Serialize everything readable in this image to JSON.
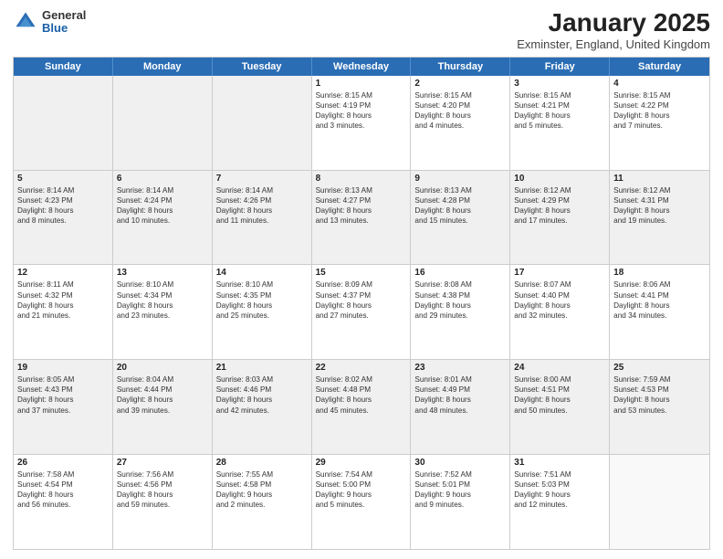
{
  "logo": {
    "general": "General",
    "blue": "Blue"
  },
  "title": {
    "month": "January 2025",
    "location": "Exminster, England, United Kingdom"
  },
  "header_days": [
    "Sunday",
    "Monday",
    "Tuesday",
    "Wednesday",
    "Thursday",
    "Friday",
    "Saturday"
  ],
  "weeks": [
    [
      {
        "day": "",
        "lines": [],
        "shaded": true
      },
      {
        "day": "",
        "lines": [],
        "shaded": true
      },
      {
        "day": "",
        "lines": [],
        "shaded": true
      },
      {
        "day": "1",
        "lines": [
          "Sunrise: 8:15 AM",
          "Sunset: 4:19 PM",
          "Daylight: 8 hours",
          "and 3 minutes."
        ]
      },
      {
        "day": "2",
        "lines": [
          "Sunrise: 8:15 AM",
          "Sunset: 4:20 PM",
          "Daylight: 8 hours",
          "and 4 minutes."
        ]
      },
      {
        "day": "3",
        "lines": [
          "Sunrise: 8:15 AM",
          "Sunset: 4:21 PM",
          "Daylight: 8 hours",
          "and 5 minutes."
        ]
      },
      {
        "day": "4",
        "lines": [
          "Sunrise: 8:15 AM",
          "Sunset: 4:22 PM",
          "Daylight: 8 hours",
          "and 7 minutes."
        ]
      }
    ],
    [
      {
        "day": "5",
        "lines": [
          "Sunrise: 8:14 AM",
          "Sunset: 4:23 PM",
          "Daylight: 8 hours",
          "and 8 minutes."
        ],
        "shaded": true
      },
      {
        "day": "6",
        "lines": [
          "Sunrise: 8:14 AM",
          "Sunset: 4:24 PM",
          "Daylight: 8 hours",
          "and 10 minutes."
        ],
        "shaded": true
      },
      {
        "day": "7",
        "lines": [
          "Sunrise: 8:14 AM",
          "Sunset: 4:26 PM",
          "Daylight: 8 hours",
          "and 11 minutes."
        ],
        "shaded": true
      },
      {
        "day": "8",
        "lines": [
          "Sunrise: 8:13 AM",
          "Sunset: 4:27 PM",
          "Daylight: 8 hours",
          "and 13 minutes."
        ],
        "shaded": true
      },
      {
        "day": "9",
        "lines": [
          "Sunrise: 8:13 AM",
          "Sunset: 4:28 PM",
          "Daylight: 8 hours",
          "and 15 minutes."
        ],
        "shaded": true
      },
      {
        "day": "10",
        "lines": [
          "Sunrise: 8:12 AM",
          "Sunset: 4:29 PM",
          "Daylight: 8 hours",
          "and 17 minutes."
        ],
        "shaded": true
      },
      {
        "day": "11",
        "lines": [
          "Sunrise: 8:12 AM",
          "Sunset: 4:31 PM",
          "Daylight: 8 hours",
          "and 19 minutes."
        ],
        "shaded": true
      }
    ],
    [
      {
        "day": "12",
        "lines": [
          "Sunrise: 8:11 AM",
          "Sunset: 4:32 PM",
          "Daylight: 8 hours",
          "and 21 minutes."
        ]
      },
      {
        "day": "13",
        "lines": [
          "Sunrise: 8:10 AM",
          "Sunset: 4:34 PM",
          "Daylight: 8 hours",
          "and 23 minutes."
        ]
      },
      {
        "day": "14",
        "lines": [
          "Sunrise: 8:10 AM",
          "Sunset: 4:35 PM",
          "Daylight: 8 hours",
          "and 25 minutes."
        ]
      },
      {
        "day": "15",
        "lines": [
          "Sunrise: 8:09 AM",
          "Sunset: 4:37 PM",
          "Daylight: 8 hours",
          "and 27 minutes."
        ]
      },
      {
        "day": "16",
        "lines": [
          "Sunrise: 8:08 AM",
          "Sunset: 4:38 PM",
          "Daylight: 8 hours",
          "and 29 minutes."
        ]
      },
      {
        "day": "17",
        "lines": [
          "Sunrise: 8:07 AM",
          "Sunset: 4:40 PM",
          "Daylight: 8 hours",
          "and 32 minutes."
        ]
      },
      {
        "day": "18",
        "lines": [
          "Sunrise: 8:06 AM",
          "Sunset: 4:41 PM",
          "Daylight: 8 hours",
          "and 34 minutes."
        ]
      }
    ],
    [
      {
        "day": "19",
        "lines": [
          "Sunrise: 8:05 AM",
          "Sunset: 4:43 PM",
          "Daylight: 8 hours",
          "and 37 minutes."
        ],
        "shaded": true
      },
      {
        "day": "20",
        "lines": [
          "Sunrise: 8:04 AM",
          "Sunset: 4:44 PM",
          "Daylight: 8 hours",
          "and 39 minutes."
        ],
        "shaded": true
      },
      {
        "day": "21",
        "lines": [
          "Sunrise: 8:03 AM",
          "Sunset: 4:46 PM",
          "Daylight: 8 hours",
          "and 42 minutes."
        ],
        "shaded": true
      },
      {
        "day": "22",
        "lines": [
          "Sunrise: 8:02 AM",
          "Sunset: 4:48 PM",
          "Daylight: 8 hours",
          "and 45 minutes."
        ],
        "shaded": true
      },
      {
        "day": "23",
        "lines": [
          "Sunrise: 8:01 AM",
          "Sunset: 4:49 PM",
          "Daylight: 8 hours",
          "and 48 minutes."
        ],
        "shaded": true
      },
      {
        "day": "24",
        "lines": [
          "Sunrise: 8:00 AM",
          "Sunset: 4:51 PM",
          "Daylight: 8 hours",
          "and 50 minutes."
        ],
        "shaded": true
      },
      {
        "day": "25",
        "lines": [
          "Sunrise: 7:59 AM",
          "Sunset: 4:53 PM",
          "Daylight: 8 hours",
          "and 53 minutes."
        ],
        "shaded": true
      }
    ],
    [
      {
        "day": "26",
        "lines": [
          "Sunrise: 7:58 AM",
          "Sunset: 4:54 PM",
          "Daylight: 8 hours",
          "and 56 minutes."
        ]
      },
      {
        "day": "27",
        "lines": [
          "Sunrise: 7:56 AM",
          "Sunset: 4:56 PM",
          "Daylight: 8 hours",
          "and 59 minutes."
        ]
      },
      {
        "day": "28",
        "lines": [
          "Sunrise: 7:55 AM",
          "Sunset: 4:58 PM",
          "Daylight: 9 hours",
          "and 2 minutes."
        ]
      },
      {
        "day": "29",
        "lines": [
          "Sunrise: 7:54 AM",
          "Sunset: 5:00 PM",
          "Daylight: 9 hours",
          "and 5 minutes."
        ]
      },
      {
        "day": "30",
        "lines": [
          "Sunrise: 7:52 AM",
          "Sunset: 5:01 PM",
          "Daylight: 9 hours",
          "and 9 minutes."
        ]
      },
      {
        "day": "31",
        "lines": [
          "Sunrise: 7:51 AM",
          "Sunset: 5:03 PM",
          "Daylight: 9 hours",
          "and 12 minutes."
        ]
      },
      {
        "day": "",
        "lines": []
      }
    ]
  ]
}
